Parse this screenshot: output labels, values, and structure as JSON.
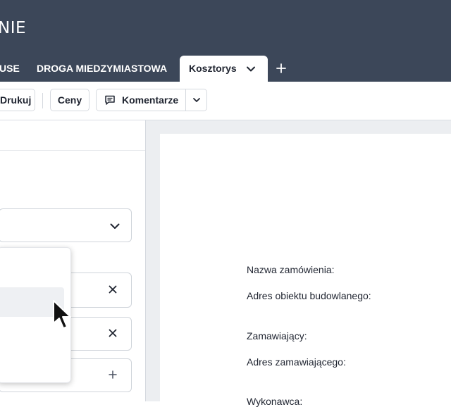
{
  "header": {
    "app_title": "NIE",
    "tabs": [
      {
        "label": "USE"
      },
      {
        "label": "DROGA MIEDZYMIASTOWA"
      }
    ],
    "active_tab": {
      "label": "Kosztorys"
    }
  },
  "toolbar": {
    "print_label": "Drukuj",
    "prices_label": "Ceny",
    "comments_label": "Komentarze"
  },
  "document": {
    "labels": [
      "Nazwa zamówienia:",
      "Adres obiektu budowlanego:",
      "Zamawiający:",
      "Adres zamawiającego:",
      "Wykonawca:"
    ]
  }
}
